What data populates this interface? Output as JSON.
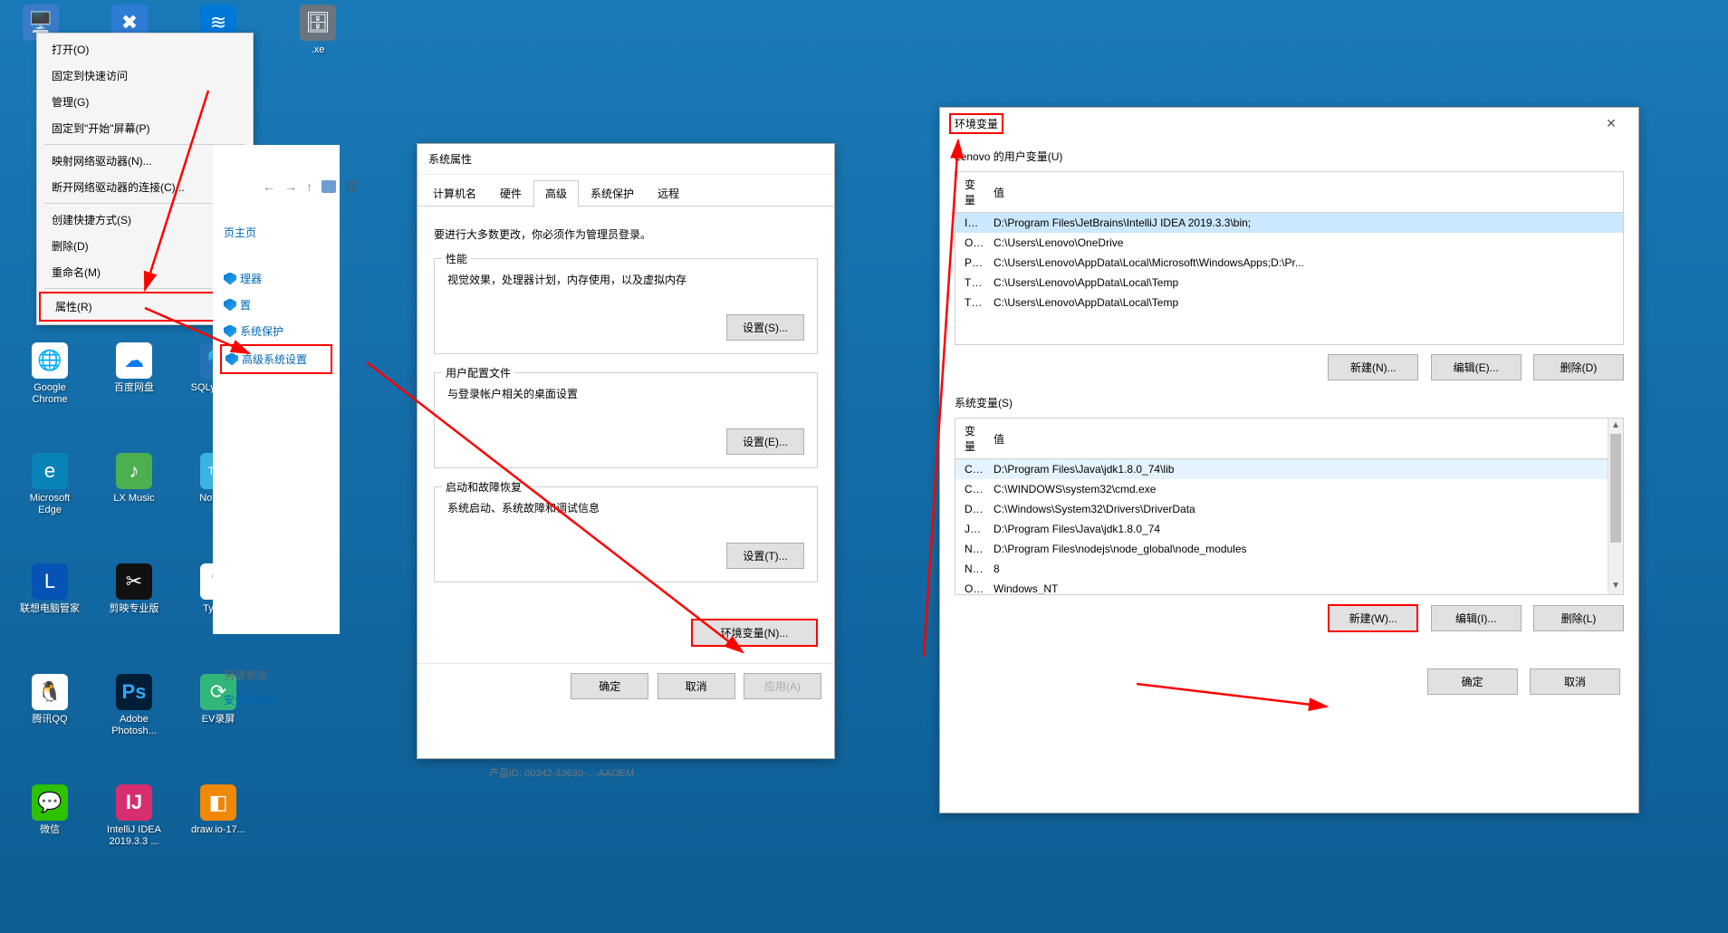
{
  "desktop_icons": {
    "folder1_label": ".xe",
    "chrome_label": "Google\nChrome",
    "baidudisk_label": "百度网盘",
    "sqlyog_label": "SQLyog -\nbit",
    "edge_label": "Microsoft\nEdge",
    "lxmusic_label": "LX Music",
    "notepad_label": "Notepad",
    "lenovo_label": "联想电脑管家",
    "jianying_label": "剪映专业版",
    "typora_label": "Typora",
    "qq_label": "腾讯QQ",
    "photoshop_label": "Adobe\nPhotosh...",
    "evrec_label": "EV录屏",
    "wechat_label": "微信",
    "intellij_label": "IntelliJ IDEA\n2019.3.3 ...",
    "drawio_label": "draw.io-17..."
  },
  "context_menu": {
    "open": "打开(O)",
    "pin_quick": "固定到快速访问",
    "manage": "管理(G)",
    "pin_start": "固定到\"开始\"屏幕(P)",
    "map_drive": "映射网络驱动器(N)...",
    "disconnect_drive": "断开网络驱动器的连接(C)...",
    "create_shortcut": "创建快捷方式(S)",
    "delete": "删除(D)",
    "rename": "重命名(M)",
    "properties": "属性(R)"
  },
  "settings_side": {
    "home": "页主页",
    "device_mgr": "理器",
    "remote": "置",
    "sys_protect": "系统保护",
    "advanced": "高级系统设置",
    "see_also": "另请参阅",
    "security": "安全和维护"
  },
  "nav": {
    "path_fragment": "控"
  },
  "sys_props": {
    "title": "系统属性",
    "tabs": {
      "computer_name": "计算机名",
      "hardware": "硬件",
      "advanced": "高级",
      "sys_protect": "系统保护",
      "remote": "远程"
    },
    "hint": "要进行大多数更改，你必须作为管理员登录。",
    "perf": {
      "legend": "性能",
      "desc": "视觉效果，处理器计划，内存使用，以及虚拟内存",
      "btn": "设置(S)..."
    },
    "profile": {
      "legend": "用户配置文件",
      "desc": "与登录帐户相关的桌面设置",
      "btn": "设置(E)..."
    },
    "startup": {
      "legend": "启动和故障恢复",
      "desc": "系统启动、系统故障和调试信息",
      "btn": "设置(T)..."
    },
    "env_btn": "环境变量(N)...",
    "ok": "确定",
    "cancel": "取消",
    "apply": "应用(A)"
  },
  "bottom_strip": "产品ID: 00342-33630-...-AAOEM",
  "env_dialog": {
    "title": "环境变量",
    "user_section_label": "Lenovo 的用户变量(U)",
    "sys_section_label": "系统变量(S)",
    "col_var": "变量",
    "col_val": "值",
    "user_vars": [
      {
        "name": "IntelliJ IDEA",
        "value": "D:\\Program Files\\JetBrains\\IntelliJ IDEA 2019.3.3\\bin;"
      },
      {
        "name": "OneDrive",
        "value": "C:\\Users\\Lenovo\\OneDrive"
      },
      {
        "name": "Path",
        "value": "C:\\Users\\Lenovo\\AppData\\Local\\Microsoft\\WindowsApps;D:\\Pr..."
      },
      {
        "name": "TEMP",
        "value": "C:\\Users\\Lenovo\\AppData\\Local\\Temp"
      },
      {
        "name": "TMP",
        "value": "C:\\Users\\Lenovo\\AppData\\Local\\Temp"
      }
    ],
    "sys_vars": [
      {
        "name": "CLASSPATH",
        "value": "D:\\Program Files\\Java\\jdk1.8.0_74\\lib"
      },
      {
        "name": "ComSpec",
        "value": "C:\\WINDOWS\\system32\\cmd.exe"
      },
      {
        "name": "DriverData",
        "value": "C:\\Windows\\System32\\Drivers\\DriverData"
      },
      {
        "name": "JAVA_HOME",
        "value": "D:\\Program Files\\Java\\jdk1.8.0_74"
      },
      {
        "name": "NODE_PATH",
        "value": "D:\\Program Files\\nodejs\\node_global\\node_modules"
      },
      {
        "name": "NUMBER_OF_PROCESSORS",
        "value": "8"
      },
      {
        "name": "OS",
        "value": "Windows_NT"
      }
    ],
    "user_btns": {
      "new": "新建(N)...",
      "edit": "编辑(E)...",
      "delete": "删除(D)"
    },
    "sys_btns": {
      "new": "新建(W)...",
      "edit": "编辑(I)...",
      "delete": "删除(L)"
    },
    "ok": "确定",
    "cancel": "取消"
  }
}
